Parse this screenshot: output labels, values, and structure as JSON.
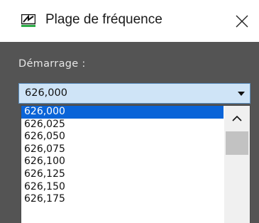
{
  "window": {
    "title": "Plage de fréquence",
    "icon": "equalizer-app-icon",
    "close_icon": "close-icon"
  },
  "form": {
    "start_label": "Démarrage :",
    "start_value": "626,000"
  },
  "dropdown": {
    "options": [
      "626,000",
      "626,025",
      "626,050",
      "626,075",
      "626,100",
      "626,125",
      "626,150",
      "626,175"
    ],
    "selected_index": 0,
    "scroll_up_icon": "chevron-up-icon"
  },
  "colors": {
    "selection": "#0a64d8",
    "combo_background": "#cfe4f7",
    "panel_background": "#545454",
    "icon_accent": "#2fae49"
  }
}
